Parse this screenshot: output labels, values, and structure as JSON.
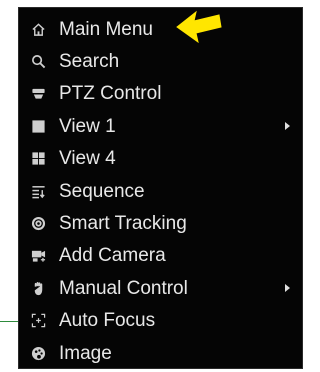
{
  "menu": {
    "items": [
      {
        "label": "Main Menu",
        "icon": "home-icon",
        "submenu": false
      },
      {
        "label": "Search",
        "icon": "search-icon",
        "submenu": false
      },
      {
        "label": "PTZ Control",
        "icon": "ptz-icon",
        "submenu": false
      },
      {
        "label": "View 1",
        "icon": "single-view-icon",
        "submenu": true
      },
      {
        "label": "View 4",
        "icon": "quad-view-icon",
        "submenu": false
      },
      {
        "label": "Sequence",
        "icon": "sequence-icon",
        "submenu": false
      },
      {
        "label": "Smart Tracking",
        "icon": "smart-tracking-icon",
        "submenu": false
      },
      {
        "label": "Add Camera",
        "icon": "add-camera-icon",
        "submenu": false
      },
      {
        "label": "Manual Control",
        "icon": "manual-control-icon",
        "submenu": true
      },
      {
        "label": "Auto Focus",
        "icon": "auto-focus-icon",
        "submenu": false
      },
      {
        "label": "Image",
        "icon": "image-icon",
        "submenu": false
      }
    ]
  },
  "annotation": {
    "icon": "arrow-icon",
    "color": "#ffe600"
  },
  "colors": {
    "menu_background": "#050505",
    "text": "#e8e8e8"
  }
}
